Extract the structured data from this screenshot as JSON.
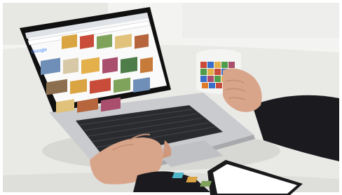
{
  "photo": {
    "subject": "",
    "screen": {
      "brand_logo_text": "Google",
      "thumbnail_colors": [
        "#d9a441",
        "#c94b3a",
        "#7fa35b",
        "#e0c27a",
        "#b6653d",
        "#6f8fb8",
        "#d7c9a6",
        "#a94f6d",
        "#e3b04b",
        "#8c6f4e",
        "#4f7d4a",
        "#c77b3a"
      ]
    },
    "colors": {
      "table": "#e9e9e6",
      "wall": "#f3f3f1",
      "laptop_silver": "#c9cbce",
      "screen_bezel": "#101010",
      "sleeve": "#1b1b1f",
      "skin": "#d9a58a",
      "mug_white": "#f4f4f2"
    }
  }
}
